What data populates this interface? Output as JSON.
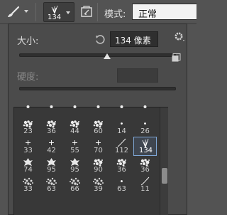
{
  "toolbar": {
    "tool_icon": "brush-icon",
    "preset_icon": "brush-preset-picker-icon",
    "preset_size": "134",
    "panel_toggle_icon": "brush-panel-toggle-icon",
    "mode_label": "模式:",
    "mode_value": "正常"
  },
  "brush_panel": {
    "size_label": "大小:",
    "size_value": "134 像素",
    "size_fraction": 0.56,
    "reset_icon": "reset-size-icon",
    "settings_icon": "gear-icon",
    "new_preset_icon": "new-preset-icon",
    "hardness_label": "硬度:",
    "hardness_value": ""
  },
  "presets": [
    {
      "size": "",
      "tip": "round-soft"
    },
    {
      "size": "",
      "tip": "round-soft"
    },
    {
      "size": "",
      "tip": "round-soft"
    },
    {
      "size": "",
      "tip": "round-soft"
    },
    {
      "size": "",
      "tip": "round-soft"
    },
    {
      "size": "",
      "tip": "round-soft"
    },
    {
      "size": "23",
      "tip": "splatter"
    },
    {
      "size": "36",
      "tip": "splatter"
    },
    {
      "size": "44",
      "tip": "splatter"
    },
    {
      "size": "60",
      "tip": "splatter"
    },
    {
      "size": "14",
      "tip": "dot"
    },
    {
      "size": "26",
      "tip": "dot"
    },
    {
      "size": "33",
      "tip": "spark"
    },
    {
      "size": "42",
      "tip": "spark"
    },
    {
      "size": "55",
      "tip": "spark"
    },
    {
      "size": "70",
      "tip": "spark"
    },
    {
      "size": "112",
      "tip": "stroke"
    },
    {
      "size": "134",
      "tip": "grass",
      "selected": true
    },
    {
      "size": "74",
      "tip": "leaf"
    },
    {
      "size": "95",
      "tip": "leaf"
    },
    {
      "size": "95",
      "tip": "leaf"
    },
    {
      "size": "90",
      "tip": "splatter"
    },
    {
      "size": "36",
      "tip": "splatter"
    },
    {
      "size": "36",
      "tip": "splatter"
    },
    {
      "size": "33",
      "tip": "texture"
    },
    {
      "size": "63",
      "tip": "texture"
    },
    {
      "size": "66",
      "tip": "texture"
    },
    {
      "size": "39",
      "tip": "texture"
    },
    {
      "size": "63",
      "tip": "dot"
    },
    {
      "size": "11",
      "tip": "stroke"
    }
  ],
  "scroll_fraction": 0.55
}
